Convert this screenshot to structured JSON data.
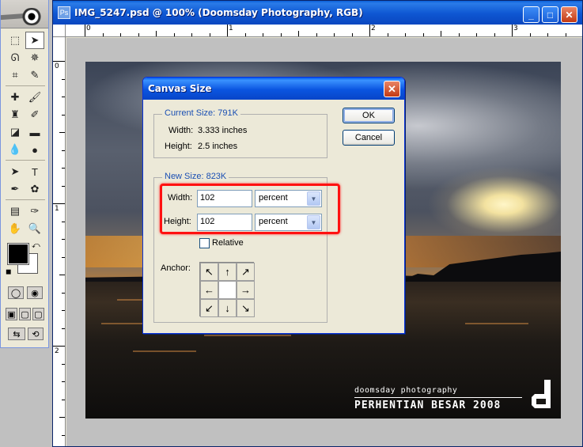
{
  "toolbox": {
    "tools": [
      {
        "name": "marquee-tool",
        "glyph": "⬚",
        "active": false
      },
      {
        "name": "move-tool",
        "glyph": "➤",
        "active": true
      },
      {
        "name": "lasso-tool",
        "glyph": "ᘏ",
        "active": false
      },
      {
        "name": "magic-wand-tool",
        "glyph": "✵",
        "active": false
      },
      {
        "name": "crop-tool",
        "glyph": "⌗",
        "active": false
      },
      {
        "name": "slice-tool",
        "glyph": "✎",
        "active": false
      },
      {
        "name": "healing-brush-tool",
        "glyph": "✚",
        "active": false
      },
      {
        "name": "brush-tool",
        "glyph": "🖌",
        "active": false
      },
      {
        "name": "clone-stamp-tool",
        "glyph": "♜",
        "active": false
      },
      {
        "name": "history-brush-tool",
        "glyph": "✐",
        "active": false
      },
      {
        "name": "eraser-tool",
        "glyph": "◪",
        "active": false
      },
      {
        "name": "gradient-tool",
        "glyph": "▬",
        "active": false
      },
      {
        "name": "blur-tool",
        "glyph": "💧",
        "active": false
      },
      {
        "name": "dodge-tool",
        "glyph": "●",
        "active": false
      },
      {
        "name": "path-selection-tool",
        "glyph": "➤",
        "active": false
      },
      {
        "name": "type-tool",
        "glyph": "T",
        "active": false
      },
      {
        "name": "pen-tool",
        "glyph": "✒",
        "active": false
      },
      {
        "name": "shape-tool",
        "glyph": "✿",
        "active": false
      },
      {
        "name": "notes-tool",
        "glyph": "▤",
        "active": false
      },
      {
        "name": "eyedropper-tool",
        "glyph": "✑",
        "active": false
      },
      {
        "name": "hand-tool",
        "glyph": "✋",
        "active": false
      },
      {
        "name": "zoom-tool",
        "glyph": "🔍",
        "active": false
      }
    ],
    "colors": {
      "foreground": "#000000",
      "background": "#ffffff"
    }
  },
  "document": {
    "title": "IMG_5247.psd @ 100% (Doomsday Photography, RGB)",
    "ruler_top_labels": [
      "0",
      "1",
      "2",
      "3"
    ],
    "ruler_left_labels": [
      "0",
      "1",
      "2"
    ],
    "watermark": {
      "line1": "doomsday photography",
      "line2": "PERHENTIAN BESAR 2008"
    }
  },
  "dialog": {
    "title": "Canvas Size",
    "current_size": {
      "legend": "Current Size: 791K",
      "width_label": "Width:",
      "width_value": "3.333 inches",
      "height_label": "Height:",
      "height_value": "2.5 inches"
    },
    "new_size": {
      "legend": "New Size: 823K",
      "width_label": "Width:",
      "width_value": "102",
      "width_unit": "percent",
      "height_label": "Height:",
      "height_value": "102",
      "height_unit": "percent",
      "relative_label": "Relative",
      "relative_checked": false,
      "anchor_label": "Anchor:"
    },
    "ok_label": "OK",
    "cancel_label": "Cancel"
  }
}
